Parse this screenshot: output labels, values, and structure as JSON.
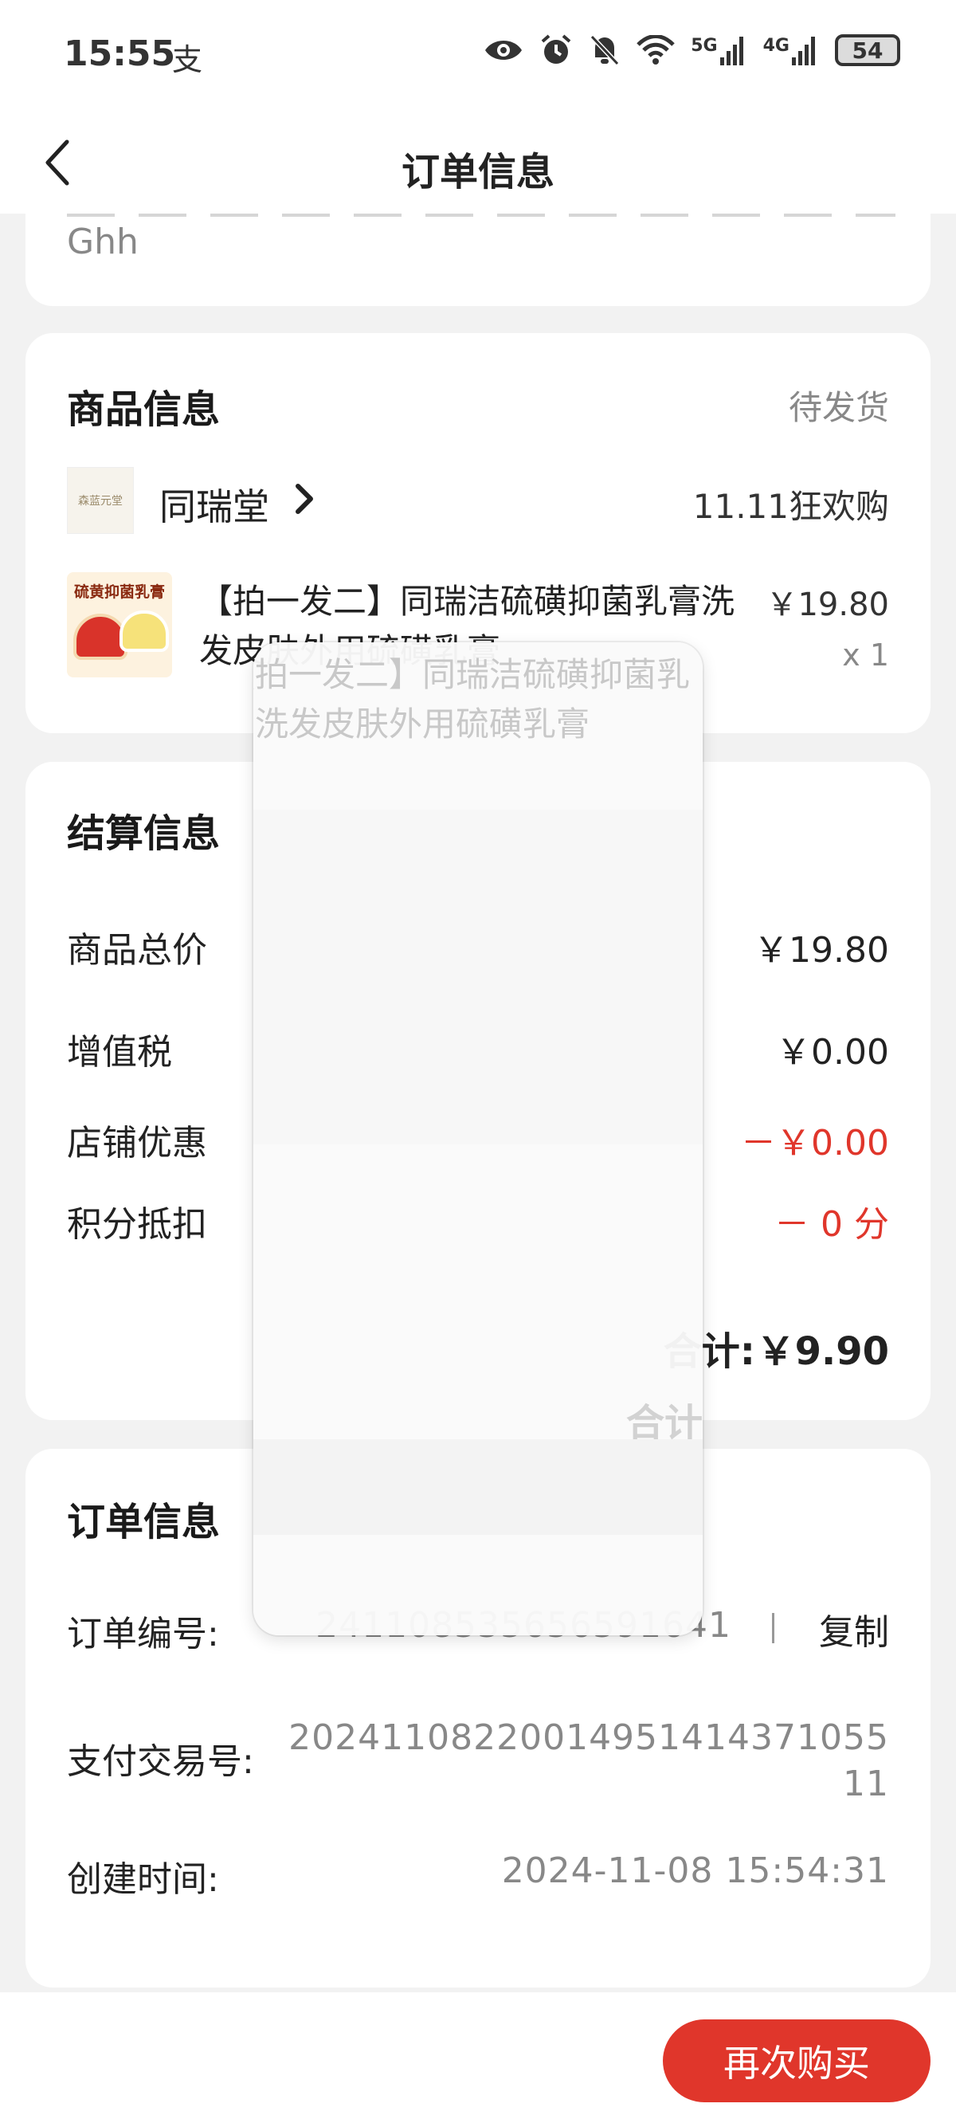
{
  "status_bar": {
    "time": "15:55",
    "alipay_glyph": "支",
    "sig5g": "5G",
    "sig4g": "4G",
    "battery": "54",
    "icons": [
      "eye-icon",
      "alarm-icon",
      "mute-icon",
      "wifi-icon",
      "signal-icon",
      "battery-icon"
    ]
  },
  "nav": {
    "title": "订单信息"
  },
  "address": {
    "line2": "Ghh"
  },
  "goods": {
    "title": "商品信息",
    "status": "待发货",
    "shop_name": "同瑞堂",
    "shop_logo_text": "森蓝元堂",
    "promo": "11.11狂欢购",
    "product_image_label": "硫黄抑菌乳膏",
    "product_name": "【拍一发二】同瑞洁硫磺抑菌乳膏洗发皮肤外用硫磺乳膏",
    "price": "￥19.80",
    "qty": "x 1"
  },
  "settlement": {
    "title": "结算信息",
    "rows": [
      {
        "label": "商品总价",
        "value": "￥19.80"
      },
      {
        "label": "增值税",
        "value": "￥0.00"
      },
      {
        "label": "店铺优惠",
        "value": "－￥0.00"
      },
      {
        "label": "积分抵扣",
        "value": "－ 0 分"
      }
    ],
    "total_label": "合计:",
    "total_value": "￥9.90"
  },
  "order": {
    "title": "订单信息",
    "order_no_label": "订单编号:",
    "order_no": "241108535656591641",
    "copy_label": "复制",
    "pay_no_label": "支付交易号:",
    "pay_no": "2024110822001495141437105511",
    "created_label": "创建时间:",
    "created": "2024-11-08 15:54:31"
  },
  "ghost": {
    "text": "【拍一发二】同瑞洁硫磺抑菌乳膏洗发皮肤外用硫磺乳膏",
    "total": "合计"
  },
  "bottom": {
    "buy_again": "再次购买"
  },
  "colors": {
    "accent_red": "#e0362b",
    "background": "#f2f2f2",
    "card": "#ffffff"
  }
}
